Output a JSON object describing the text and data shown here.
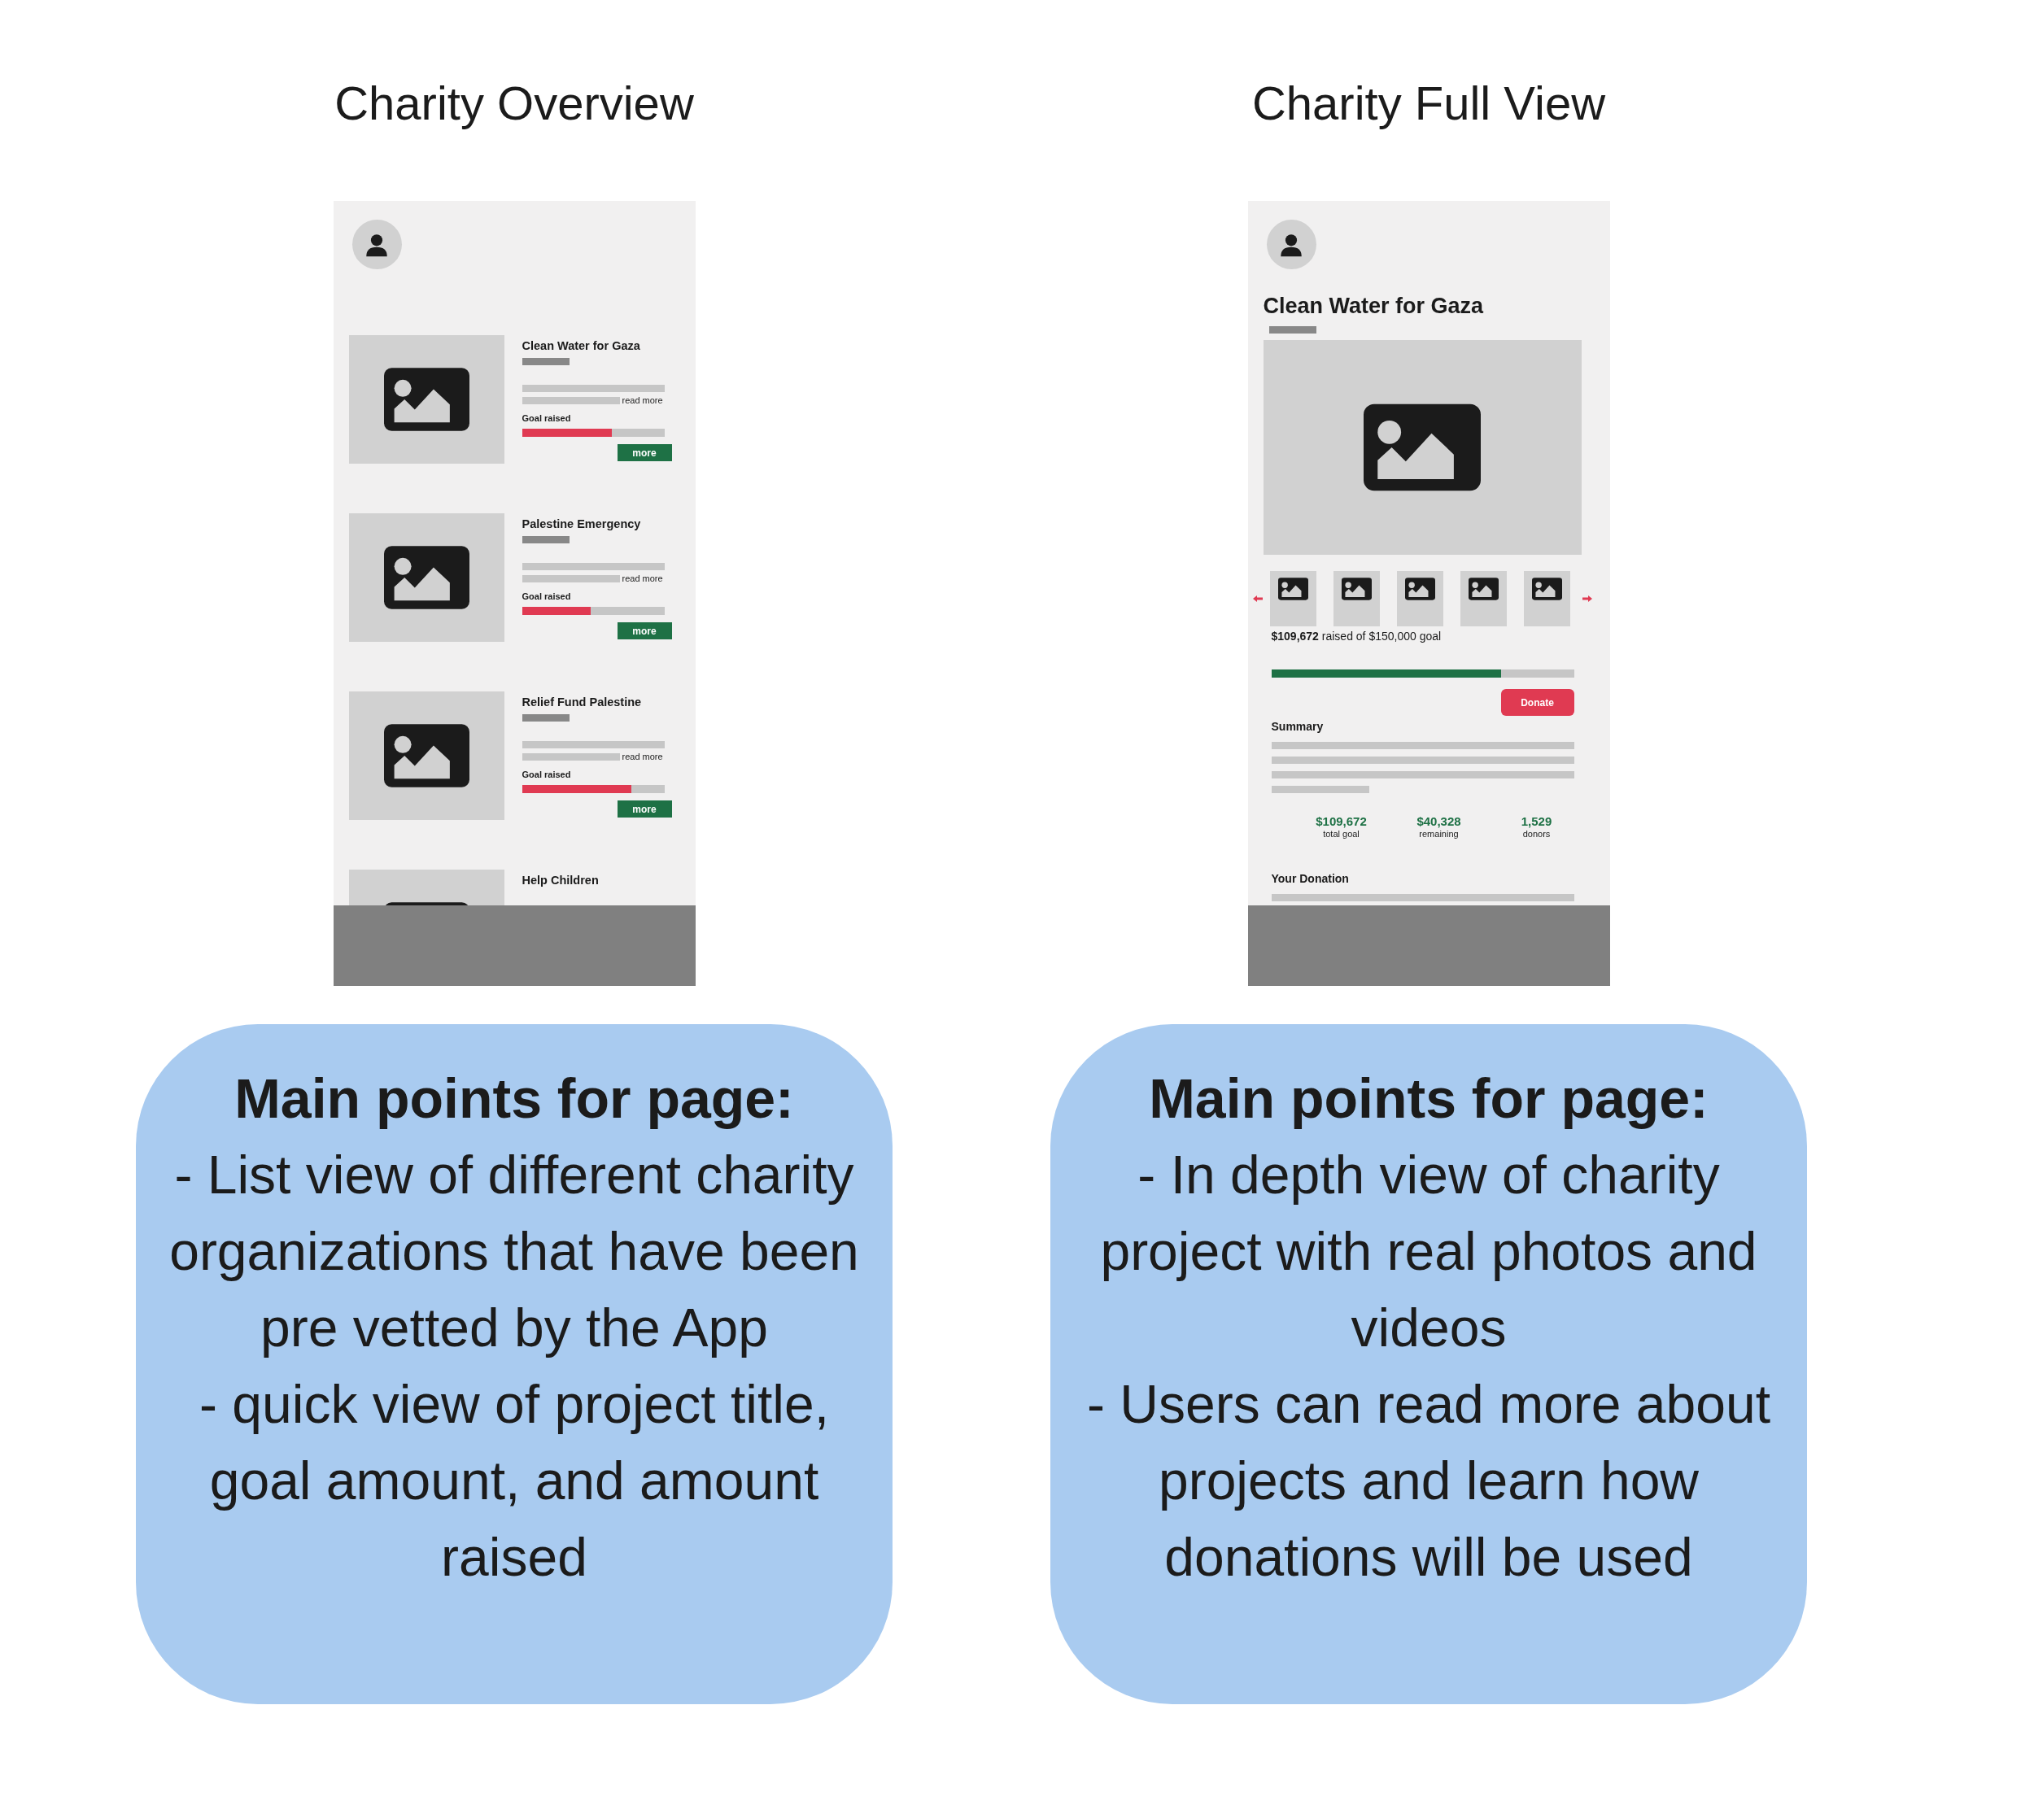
{
  "overview": {
    "heading": "Charity Overview",
    "cards": [
      {
        "title": "Clean Water for Gaza",
        "link": "read more",
        "goal_label": "Goal raised",
        "level": 0.63,
        "button": "more"
      },
      {
        "title": "Palestine Emergency",
        "link": "read more",
        "goal_label": "Goal raised",
        "level": 0.48,
        "button": "more"
      },
      {
        "title": "Relief Fund Palestine",
        "link": "read more",
        "goal_label": "Goal raised",
        "level": 0.77,
        "button": "more"
      },
      {
        "title": "Help Children"
      }
    ]
  },
  "full_view": {
    "heading": "Charity Full View",
    "title": "Clean Water for Gaza",
    "thumbnails": [
      {
        "kind": "image"
      },
      {
        "kind": "image"
      },
      {
        "kind": "image"
      },
      {
        "kind": "image"
      },
      {
        "kind": "image"
      }
    ],
    "raised": "**$109,672** raised of $150,000 goal",
    "level": 0.76,
    "button": "Donate",
    "summary_heading": "Summary",
    "stats": [
      {
        "value": "$109,672",
        "label": "total goal"
      },
      {
        "value": "$40,328",
        "label": "remaining"
      },
      {
        "value": "1,529",
        "label": "donors"
      }
    ],
    "donation_heading": "Your Donation"
  },
  "notes": [
    {
      "heading": "Main points for page:",
      "points": [
        "- List view of different charity organizations that have been pre vetted by the App",
        "- quick view of project title, goal amount, and amount raised"
      ]
    },
    {
      "heading": "Main points for page:",
      "points": [
        "- In depth view of charity project with real photos and videos",
        "- Users can read more about projects and learn how donations will be used"
      ]
    }
  ]
}
